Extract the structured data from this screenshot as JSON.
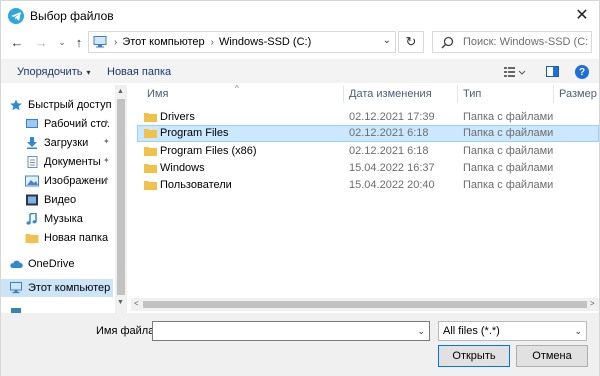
{
  "window": {
    "title": "Выбор файлов",
    "close_glyph": "✕"
  },
  "nav": {
    "back_glyph": "←",
    "forward_glyph": "→",
    "recent_glyph": "⌄",
    "up_glyph": "↑",
    "path_separator": "›",
    "path": [
      "Этот компьютер",
      "Windows-SSD (C:)"
    ],
    "address_dropdown_glyph": "⌄",
    "refresh_glyph": "↻",
    "search_placeholder": "Поиск: Windows-SSD (C:)"
  },
  "commands": {
    "organize": "Упорядочить",
    "organize_caret": "▾",
    "new_folder": "Новая папка",
    "help": "?"
  },
  "sidebar": {
    "items": [
      {
        "label": "Быстрый доступ",
        "icon": "star-icon",
        "pinned": false
      },
      {
        "label": "Рабочий сто.",
        "icon": "desktop-icon",
        "pinned": true
      },
      {
        "label": "Загрузки",
        "icon": "download-icon",
        "pinned": true
      },
      {
        "label": "Документы",
        "icon": "documents-icon",
        "pinned": true
      },
      {
        "label": "Изображени",
        "icon": "pictures-icon",
        "pinned": true
      },
      {
        "label": "Видео",
        "icon": "video-icon",
        "pinned": false
      },
      {
        "label": "Музыка",
        "icon": "music-icon",
        "pinned": false
      },
      {
        "label": "Новая папка",
        "icon": "folder-icon",
        "pinned": false
      },
      {
        "label": "OneDrive",
        "icon": "cloud-icon",
        "pinned": false
      },
      {
        "label": "Этот компьютер",
        "icon": "computer-icon",
        "pinned": false,
        "selected": true
      }
    ],
    "pin_glyph": "📌",
    "scroll_up_glyph": "▲",
    "scroll_down_glyph": "▼"
  },
  "columns": {
    "name": "Имя",
    "date": "Дата изменения",
    "type": "Тип",
    "size": "Размер",
    "sort_glyph": "^"
  },
  "files": [
    {
      "name": "Drivers",
      "date": "02.12.2021 17:39",
      "type": "Папка с файлами",
      "selected": false
    },
    {
      "name": "Program Files",
      "date": "02.12.2021 6:18",
      "type": "Папка с файлами",
      "selected": true
    },
    {
      "name": "Program Files (x86)",
      "date": "02.12.2021 6:18",
      "type": "Папка с файлами",
      "selected": false
    },
    {
      "name": "Windows",
      "date": "15.04.2022 16:37",
      "type": "Папка с файлами",
      "selected": false
    },
    {
      "name": "Пользователи",
      "date": "15.04.2022 20:40",
      "type": "Папка с файлами",
      "selected": false
    }
  ],
  "hscroll": {
    "left_glyph": "<",
    "right_glyph": ">"
  },
  "bottom": {
    "filename_label": "Имя файла:",
    "filename_value": "",
    "filename_dropdown_glyph": "⌄",
    "filter_value": "All files (*.*)",
    "filter_dropdown_glyph": "⌄",
    "open_label": "Открыть",
    "cancel_label": "Отмена"
  },
  "colors": {
    "accent": "#0078d7",
    "selection": "#cce8ff",
    "folder": "#f0c24b",
    "app_icon": "#2ea6e2"
  }
}
